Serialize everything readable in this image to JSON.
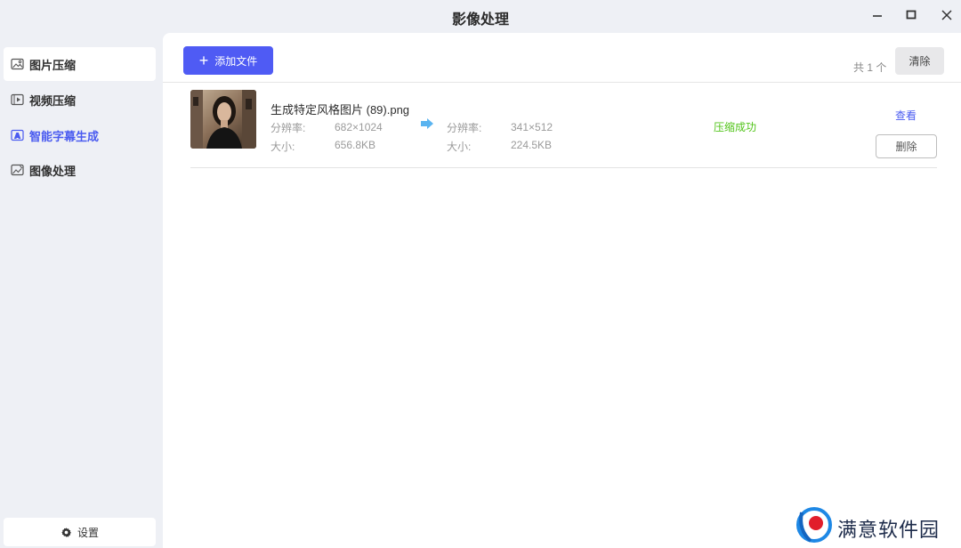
{
  "window": {
    "title": "影像处理"
  },
  "sidebar": {
    "items": [
      {
        "label": "图片压缩",
        "icon": "image-icon"
      },
      {
        "label": "视频压缩",
        "icon": "video-icon"
      },
      {
        "label": "智能字幕生成",
        "icon": "subtitle-icon"
      },
      {
        "label": "图像处理",
        "icon": "image-edit-icon"
      }
    ],
    "settings_label": "设置"
  },
  "toolbar": {
    "add_label": "添加文件",
    "total_label": "共 1 个",
    "clear_label": "清除"
  },
  "files": [
    {
      "name": "生成特定风格图片 (89).png",
      "original": {
        "resolution_label": "分辨率:",
        "resolution": "682×1024",
        "size_label": "大小:",
        "size": "656.8KB"
      },
      "compressed": {
        "resolution_label": "分辨率:",
        "resolution": "341×512",
        "size_label": "大小:",
        "size": "224.5KB"
      },
      "status": "压缩成功",
      "view_label": "查看",
      "delete_label": "删除"
    }
  ],
  "watermark": {
    "text": "满意软件园"
  },
  "colors": {
    "accent": "#4f5bf4",
    "active_nav": "#4a5bf0",
    "success": "#52c41a",
    "background": "#eef0f5"
  }
}
